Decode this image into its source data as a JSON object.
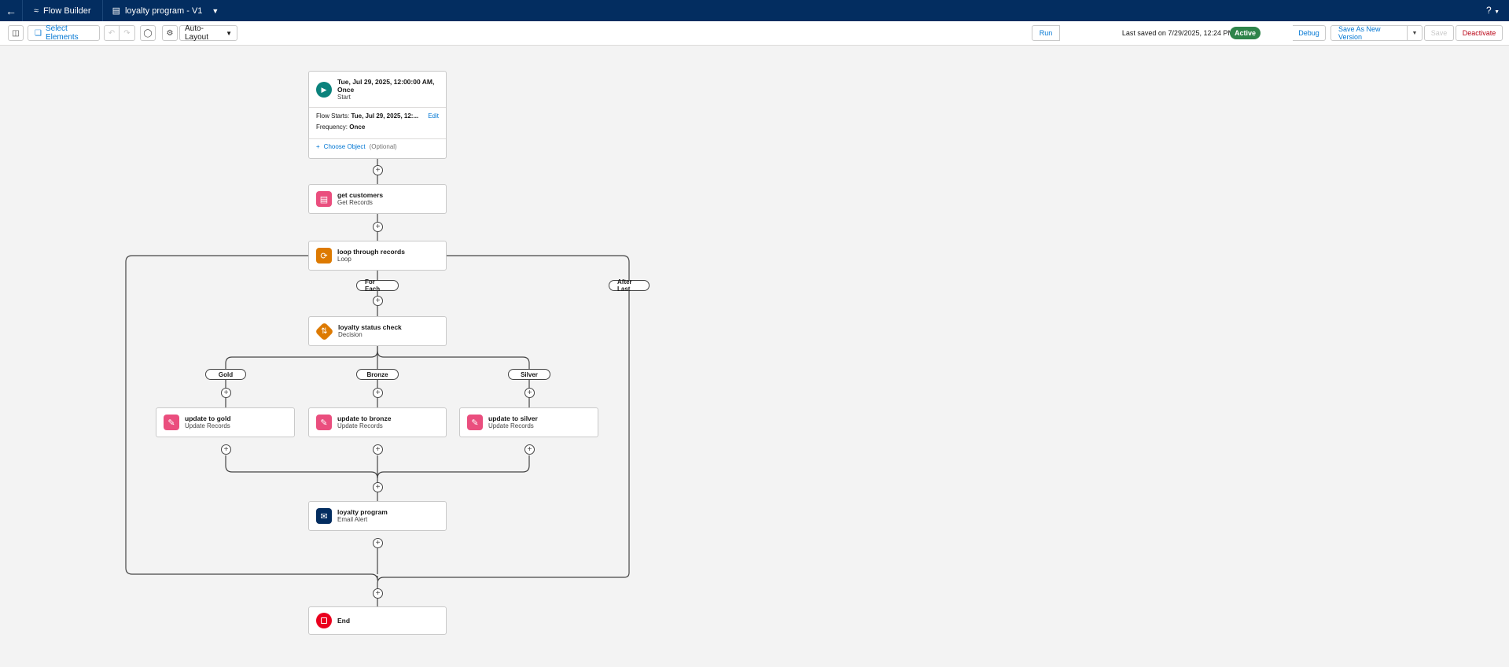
{
  "topbar": {
    "app_name": "Flow Builder",
    "flow_name": "loyalty program - V1",
    "help": "?"
  },
  "toolbar": {
    "select_elements": "Select Elements",
    "layout": "Auto-Layout",
    "last_saved": "Last saved on 7/29/2025, 12:24 PM",
    "status": "Active",
    "run": "Run",
    "debug": "Debug",
    "save_as_new": "Save As New Version",
    "save": "Save",
    "deactivate": "Deactivate"
  },
  "colors": {
    "nav": "#032d60",
    "link": "#0176d3",
    "active": "#2e844a",
    "start_icon": "#0b827c",
    "records_icon": "#ea4e7e",
    "logic_icon": "#dd7a01",
    "email_icon": "#032d60",
    "end_icon": "#ea001e"
  },
  "start": {
    "title": "Tue, Jul 29, 2025, 12:00:00 AM, Once",
    "sub": "Start",
    "flow_starts_label": "Flow Starts:",
    "flow_starts_value": "Tue, Jul 29, 2025, 12:...",
    "edit": "Edit",
    "frequency_label": "Frequency:",
    "frequency_value": "Once",
    "choose_object": "Choose Object",
    "optional": "(Optional)"
  },
  "nodes": {
    "get_customers": {
      "title": "get customers",
      "sub": "Get Records"
    },
    "loop": {
      "title": "loop through records",
      "sub": "Loop"
    },
    "decision": {
      "title": "loyalty status check",
      "sub": "Decision"
    },
    "gold": {
      "title": "update to gold",
      "sub": "Update Records"
    },
    "bronze": {
      "title": "update to bronze",
      "sub": "Update Records"
    },
    "silver": {
      "title": "update to silver",
      "sub": "Update Records"
    },
    "email": {
      "title": "loyalty program",
      "sub": "Email Alert"
    },
    "end": {
      "title": "End"
    }
  },
  "labels": {
    "for_each": "For Each",
    "after_last": "After Last",
    "gold": "Gold",
    "bronze": "Bronze",
    "silver": "Silver"
  }
}
